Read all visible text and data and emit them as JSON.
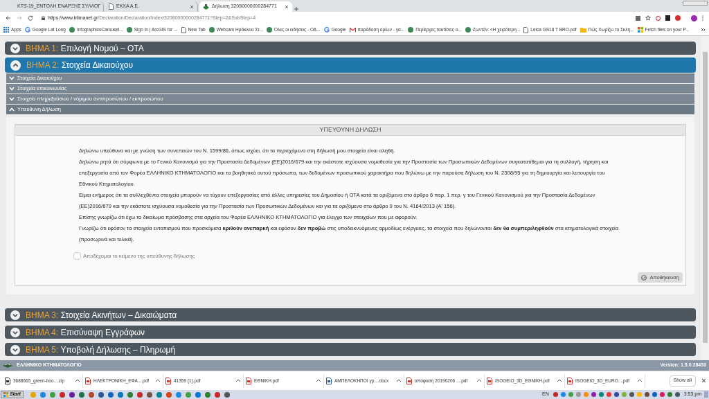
{
  "browser": {
    "tabs": [
      {
        "title": "KTS-19_ΕΝΤΟΛΗ ΕΝΑΡΞΗΣ ΣΥΛΛΟΓ",
        "kind": "mail",
        "selected": false
      },
      {
        "title": "ΕΚΧΑ Α.Ε.",
        "kind": "page",
        "selected": false
      },
      {
        "title": "Δήλωση 32080000000284771",
        "kind": "site",
        "selected": true
      }
    ],
    "url_host": "https://www.ktimanet.gr",
    "url_path": "/Declaration/Declaration/Index/32080000000284771?Step=2&SubStep=4",
    "bookmarks": [
      {
        "label": "Apps",
        "kind": "apps"
      },
      {
        "label": "Google Lat Long",
        "kind": "google"
      },
      {
        "label": "InfographicsCarousel...",
        "kind": "globe"
      },
      {
        "label": "Sign In | ArcGIS for ...",
        "kind": "globe"
      },
      {
        "label": "New Tab",
        "kind": "page"
      },
      {
        "label": "Webcam Ηράκλειο Στ...",
        "kind": "globe"
      },
      {
        "label": "Όλες οι ειδήσεις - ΟΑ...",
        "kind": "globe"
      },
      {
        "label": "Google",
        "kind": "google"
      },
      {
        "label": "παράδοση ορίων - γα...",
        "kind": "mail"
      },
      {
        "label": "Περίεργες ταυτίσεις ο...",
        "kind": "globe"
      },
      {
        "label": "Ζωντόν: «Η χειρότερη...",
        "kind": "globe"
      },
      {
        "label": "Leica GS18 T BRO.pdf",
        "kind": "page"
      },
      {
        "label": "Πώς Χωρίζω το Σκλη...",
        "kind": "folder"
      },
      {
        "label": "Fetch files on your P...",
        "kind": "windows"
      }
    ]
  },
  "steps_top": [
    {
      "label": "ΒΗΜΑ 1:",
      "title": "Επιλογή Νομού – ΟΤΑ",
      "expanded": false
    },
    {
      "label": "ΒΗΜΑ 2:",
      "title": "Στοιχεία Δικαιούχου",
      "expanded": true
    }
  ],
  "substeps": [
    {
      "title": "Στοιχεία Δικαιούχου",
      "expanded": false
    },
    {
      "title": "Στοιχεία επικοινωνίας",
      "expanded": false
    },
    {
      "title": "Στοιχεία πληρεξούσιου / νόμιμου αντιπροσώπου / εκπροσώπου",
      "expanded": false
    },
    {
      "title": "Υπεύθυνη Δήλωση",
      "expanded": true
    }
  ],
  "declaration": {
    "heading": "ΥΠΕΥΘΥΝΗ ΔΗΛΩΣΗ",
    "paragraphs": [
      "Δηλώνω υπεύθυνα και με γνώση των συνεπειών του Ν. 1599/86, όπως ισχύει, ότι τα περιεχόμενα στη δήλωσή μου στοιχεία είναι αληθή.",
      "Δηλώνω ρητά ότι σύμφωνα με το Γενικό Κανονισμό για την Προστασία Δεδομένων (ΕΕ)2016/679 και την εκάστοτε ισχύουσα νομοθεσία για την Προστασία των Προσωπικών Δεδομένων συγκατατίθεμαι για τη συλλογή, τήρηση και επεξεργασία από τον Φορέα ΕΛΛΗΝΙΚΟ ΚΤΗΜΑΤΟΛΟΓΙΟ και τα βοηθητικά αυτού πρόσωπα, των δεδομένων προσωπικού χαρακτήρα που δηλώνω με την παρούσα δήλωση του Ν. 2308/95 για τη δημιουργία και λειτουργία του Εθνικού Κτηματολογίου.",
      "Είμαι ενήμερος ότι τα συλλεχθέντα στοιχεία μπορούν να τύχουν επεξεργασίας από άλλες υπηρεσίες του Δημοσίου ή ΟΤΑ κατά τα οριζόμενα στο άρθρο 6 παρ. 1 περ. γ του Γενικού Κανονισμού για την Προστασία Δεδομένων (ΕΕ)2016/679 και την εκάστοτε ισχύουσα νομοθεσία για την Προστασία των Προσωπικών Δεδομένων και για τα οριζόμενα στο άρθρο 9 του Ν. 4164/2013 (Α' 156).",
      "Επίσης γνωρίζω ότι έχω το δικαίωμα πρόσβασης στα αρχεία του Φορέα ΕΛΛΗΝΙΚΟ ΚΤΗΜΑΤΟΛΟΓΙΟ για έλεγχο των στοιχείων που με αφορούν.",
      "Γνωρίζω ότι εφόσον τα στοιχεία εντοπισμού που προσκόμισα **κριθούν ανεπαρκή** και εφόσον **δεν προβώ** στις υποδεικνυόμενες αρμοδίως ενέργειες, τα στοιχεία που δηλώνονται **δεν θα συμπεριληφθούν** στα κτηματολογικά στοιχεία (προσωρινά και τελικά)."
    ],
    "accept_label": "Αποδέχομαι το κείμενο της υπεύθυνης δήλωσης",
    "accept_checked": false,
    "save_button": "Αποθήκευση"
  },
  "steps_bottom": [
    {
      "label": "ΒΗΜΑ 3:",
      "title": "Στοιχεία Ακινήτων – Δικαιώματα",
      "expanded": false
    },
    {
      "label": "ΒΗΜΑ 4:",
      "title": "Επισύναψη Εγγράφων",
      "expanded": false
    },
    {
      "label": "ΒΗΜΑ 5:",
      "title": "Υποβολή Δήλωσης – Πληρωμή",
      "expanded": false
    }
  ],
  "footer": {
    "org": "ΕΛΛΗΝΙΚΟ ΚΤΗΜΑΤΟΛΟΓΙΟ",
    "version": "Version: 1.5.0.28453"
  },
  "downloads": [
    {
      "name": "3688665_green-boo....zip",
      "kind": "zip"
    },
    {
      "name": "ΗΛΕΚΤΡΟΝΙΚΗ_ΕΦΑ....pdf",
      "kind": "pdf"
    },
    {
      "name": "41359 (1).pdf",
      "kind": "pdf"
    },
    {
      "name": "ΕΘΝΙΚΗ.pdf",
      "kind": "pdf"
    },
    {
      "name": "ΑΜΠΕΛΟΚΗΠΟΙ γρ....docx",
      "kind": "docx"
    },
    {
      "name": "απόφαση 20190206 ....pdf",
      "kind": "pdf"
    },
    {
      "name": "ISOGEIO_3D_ΕΘΝΙΚΗ.pdf",
      "kind": "pdf"
    },
    {
      "name": "ISOGEIO_3D_EURO....pdf",
      "kind": "pdf"
    }
  ],
  "show_all": "Show all",
  "taskbar": {
    "start": "Start",
    "language": "EN",
    "time": "3:53 pm"
  }
}
